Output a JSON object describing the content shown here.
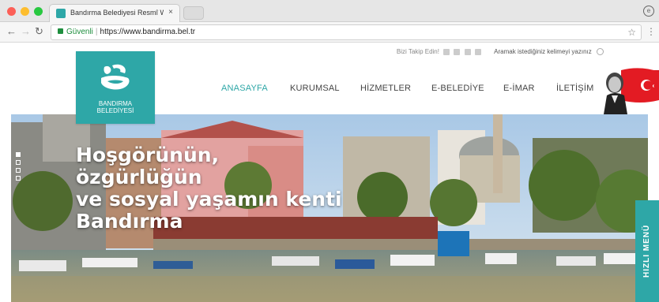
{
  "browser": {
    "tab_title": "Bandırma Belediyesi Resmî Web",
    "tab_close": "×",
    "secure_label": "Güvenli",
    "separator": "|",
    "url": "https://www.bandirma.bel.tr",
    "icons": [
      "back-arrow-icon",
      "forward-arrow-icon",
      "reload-icon",
      "lock-icon",
      "star-icon",
      "menu-icon",
      "profile-icon"
    ]
  },
  "header": {
    "follow_label": "Bizi Takip Edin!",
    "search_placeholder": "Aramak istediğiniz kelimeyi yazınız",
    "logo_line1": "BANDIRMA",
    "logo_line2": "BELEDİYESİ",
    "nav": [
      "ANASAYFA",
      "KURUMSAL",
      "HİZMETLER",
      "E-BELEDİYE",
      "E-İMAR",
      "İLETİŞİM"
    ],
    "active_nav": "ANASAYFA"
  },
  "hero": {
    "headline_lines": [
      "Hoşgörünün,",
      "özgürlüğün",
      "ve sosyal yaşamın kenti",
      "Bandırma"
    ],
    "quick_menu_label": "HIZLI MENÜ",
    "slide_count": 4,
    "active_slide": 1
  },
  "colors": {
    "brand_teal": "#2ea7a7",
    "nav_text": "#444444",
    "secure_green": "#1e8e3e"
  }
}
